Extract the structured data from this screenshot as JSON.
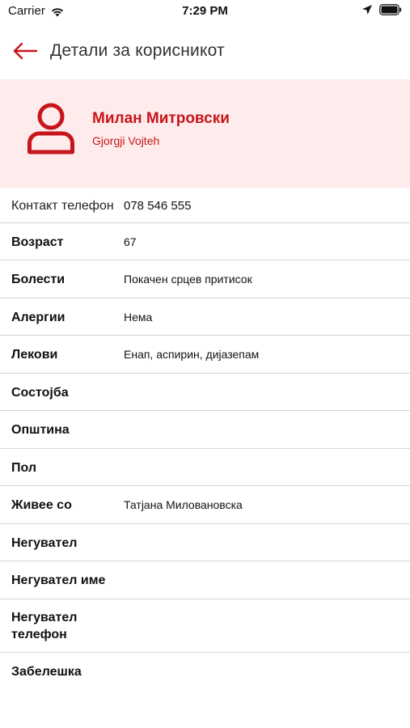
{
  "status_bar": {
    "carrier": "Carrier",
    "time": "7:29 PM"
  },
  "nav": {
    "title": "Детали за корисникот",
    "back_icon": "arrow-left-icon",
    "accent": "#c8151b"
  },
  "profile": {
    "name": "Милан Митровски",
    "subtitle": "Gjorgji Vojteh",
    "avatar_icon": "user-icon",
    "header_bg": "#fdeceb"
  },
  "details": [
    {
      "label": "Контакт телефон",
      "value": "078 546 555"
    },
    {
      "label": "Возраст",
      "value": "67"
    },
    {
      "label": "Болести",
      "value": "Покачен срцев притисок"
    },
    {
      "label": "Алергии",
      "value": "Нема"
    },
    {
      "label": "Лекови",
      "value": "Енап, аспирин, дијазепам"
    },
    {
      "label": "Состојба",
      "value": ""
    },
    {
      "label": "Општина",
      "value": ""
    },
    {
      "label": "Пол",
      "value": ""
    },
    {
      "label": "Живее со",
      "value": "Татјана Миловановска"
    },
    {
      "label": "Негувател",
      "value": ""
    },
    {
      "label": "Негувател име",
      "value": ""
    },
    {
      "label": "Негувател телефон",
      "value": ""
    },
    {
      "label": "Забелешка",
      "value": ""
    }
  ]
}
